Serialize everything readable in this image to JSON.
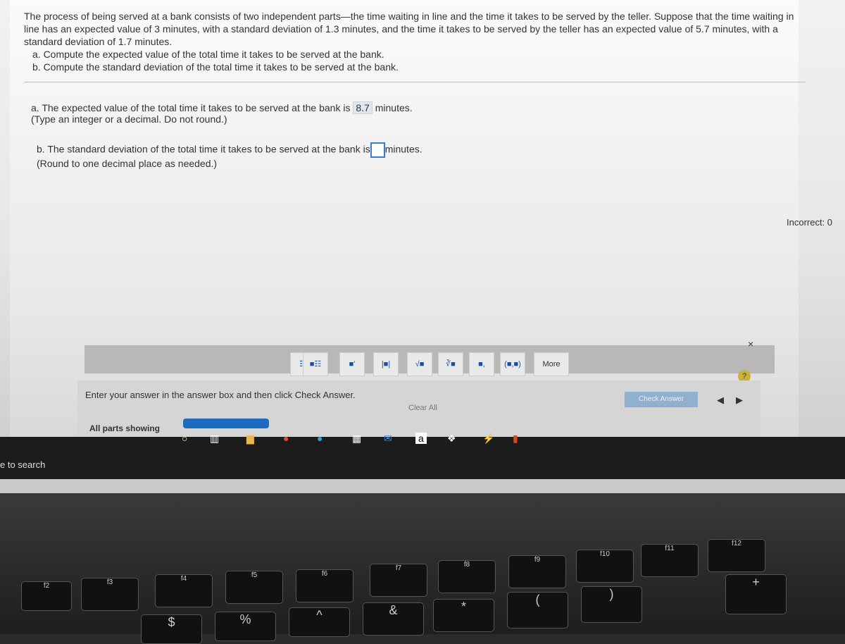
{
  "question": {
    "lines": [
      "The process of being served at a bank consists of two independent parts—the time waiting in line and the time it takes to be served by the teller. Suppose that the time waiting in line has an expected value of 3 minutes, with a standard deviation of 1.3 minutes, and the time it takes to be served by the teller has an expected value of 5.7 minutes, with a standard deviation of 1.7 minutes.",
      "a. Compute the expected value of the total time it takes to be served at the bank.",
      "b. Compute the standard deviation of the total time it takes to be served at the bank."
    ]
  },
  "answers": {
    "a_prefix": "a. The expected value of the total time it takes to be served at the bank is",
    "a_value": "8.7",
    "a_suffix": "minutes.",
    "a_hint": "(Type an integer or a decimal. Do not round.)",
    "b_prefix": "b. The standard deviation of the total time it takes to be served at the bank is",
    "b_value": "",
    "b_suffix": "minutes.",
    "b_hint": "(Round to one decimal place as needed.)"
  },
  "toolbar": {
    "buttons": [
      "☷",
      "■☷",
      "■'",
      "|■|",
      "√■",
      "∛■",
      "■,",
      "(■,■)",
      "More"
    ]
  },
  "footer": {
    "instruction": "Enter your answer in the answer box and then click Check Answer.",
    "parts": "All parts showing",
    "clear_all": "Clear All",
    "check_answer": "Check Answer",
    "help": "?",
    "close": "×",
    "progress_percent": 100
  },
  "side": {
    "incorrect": "Incorrect: 0"
  },
  "taskbar": {
    "search": "e to search"
  },
  "keyboard": {
    "keys": [
      "f2",
      "f3",
      "f4",
      "f5",
      "f6",
      "f7",
      "f8",
      "f9",
      "f10",
      "f11",
      "f12",
      "$",
      "%",
      "^",
      "&",
      "*",
      "(",
      ")",
      "+"
    ]
  }
}
